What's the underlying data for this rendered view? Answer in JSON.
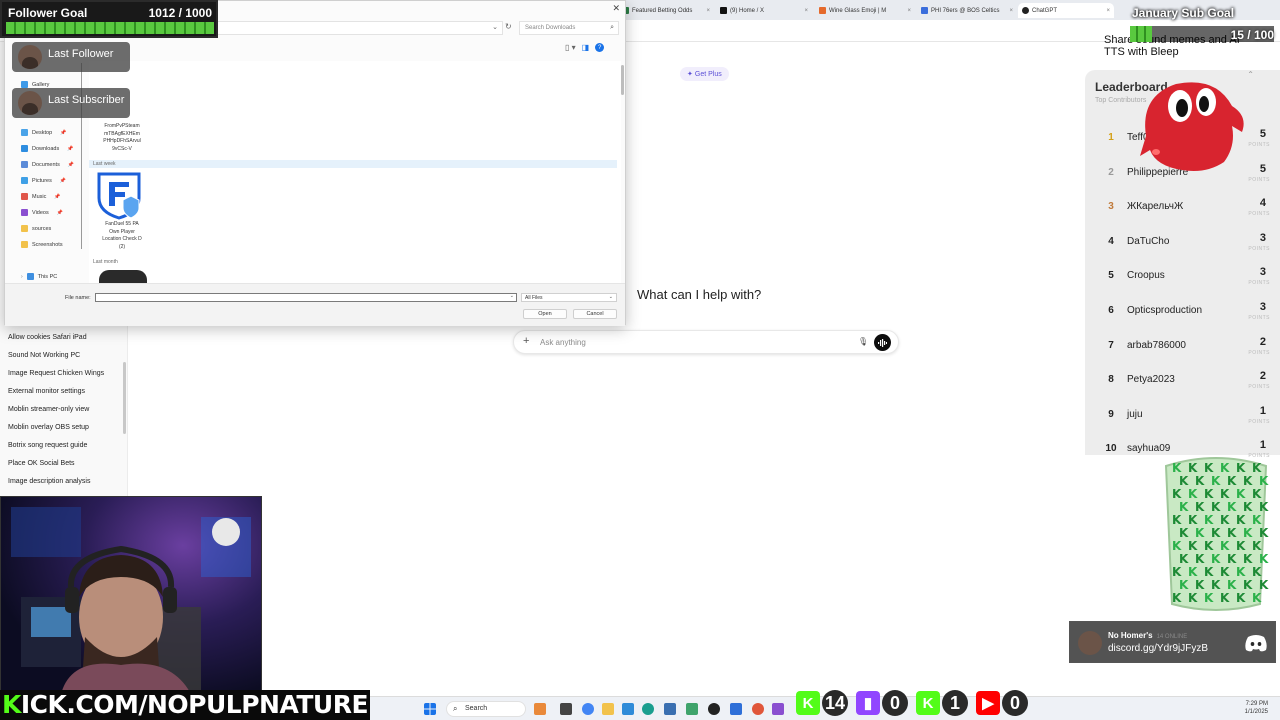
{
  "browser": {
    "tabs": [
      {
        "label": "Featured Betting Odds",
        "color": "#2d7d46"
      },
      {
        "label": "(9) Home / X",
        "color": "#111111"
      },
      {
        "label": "Wine Glass Emoji | M",
        "color": "#e56a2c"
      },
      {
        "label": "PHI 76ers @ BOS Celtics",
        "color": "#3b6edc"
      },
      {
        "label": "ChatGPT",
        "color": "#222222"
      }
    ]
  },
  "file_dialog": {
    "search_placeholder": "Search Downloads",
    "nav_items": [
      {
        "label": "Gallery",
        "color": "#3e9ae8"
      },
      {
        "label": "Desktop",
        "color": "#4aa3e8"
      },
      {
        "label": "Downloads",
        "color": "#2e8de0"
      },
      {
        "label": "Documents",
        "color": "#5b8bd8"
      },
      {
        "label": "Pictures",
        "color": "#3fa0e6"
      },
      {
        "label": "Music",
        "color": "#e0564a"
      },
      {
        "label": "Videos",
        "color": "#8a4fd0"
      },
      {
        "label": "sources",
        "color": "#f2c24b"
      },
      {
        "label": "Screenshots",
        "color": "#f2c24b"
      },
      {
        "label": "This PC",
        "color": "#3f8fe0"
      }
    ],
    "file_name_partial": "FromPvPSteam\nmTBAgfEXHEm\nPHHpDFhSArvul\n9vCSc-V",
    "group_last_week": "Last week",
    "file_fanduel": "FanDuel 55 PA\nOwn Player\nLocation Check D\n(2)",
    "group_last_month": "Last month",
    "file_name_label": "File name:",
    "file_type": "All Files",
    "open_label": "Open",
    "cancel_label": "Cancel"
  },
  "sidebar": {
    "chats": [
      "Allow cookies Safari iPad",
      "Sound Not Working PC",
      "Image Request Chicken Wings",
      "External monitor settings",
      "Moblin streamer-only view",
      "Moblin overlay OBS setup",
      "Botrix song request guide",
      "Place OK Social Bets",
      "Image description analysis"
    ]
  },
  "chatgpt": {
    "get_plus": "Get Plus",
    "prompt": "What can I help with?",
    "input_placeholder": "Ask anything"
  },
  "overlays": {
    "follower_goal": {
      "label": "Follower Goal",
      "count": "1012 / 1000",
      "progress": 1.0
    },
    "last_follower": "Last Follower",
    "last_subscriber": "Last Subscriber",
    "sub_goal": {
      "label": "January Sub Goal",
      "count": "15 / 100",
      "progress": 0.15
    },
    "share_text": "Share sound memes and AI TTS with Bleep",
    "leaderboard": {
      "title": "Leaderboard",
      "subtitle": "Top Contributors",
      "points_label": "POINTS",
      "rows": [
        {
          "rank": "1",
          "name": "Teff007",
          "points": "5",
          "rank_color": "#d4a017"
        },
        {
          "rank": "2",
          "name": "Philippepierre",
          "points": "5",
          "rank_color": "#9a9a9a"
        },
        {
          "rank": "3",
          "name": "ЖКарельчЖ",
          "points": "4",
          "rank_color": "#c07a3a"
        },
        {
          "rank": "4",
          "name": "DaTuCho",
          "points": "3",
          "rank_color": "#222222"
        },
        {
          "rank": "5",
          "name": "Croopus",
          "points": "3",
          "rank_color": "#222222"
        },
        {
          "rank": "6",
          "name": "Opticsproduction",
          "points": "3",
          "rank_color": "#222222"
        },
        {
          "rank": "7",
          "name": "arbab786000",
          "points": "2",
          "rank_color": "#222222"
        },
        {
          "rank": "8",
          "name": "Petya2023",
          "points": "2",
          "rank_color": "#222222"
        },
        {
          "rank": "9",
          "name": "juju",
          "points": "1",
          "rank_color": "#222222"
        },
        {
          "rank": "10",
          "name": "sayhua09",
          "points": "1",
          "rank_color": "#222222"
        }
      ]
    },
    "discord": {
      "name": "No Homer's",
      "online": "14 ONLINE",
      "link": "discord.gg/Ydr9jJFyzB"
    },
    "kick_prefix": "K",
    "kick_handle": "ICK.COM/NOPULPNATURE",
    "counters": [
      {
        "icon": "kick-icon",
        "value": "14",
        "color": "#53fc18"
      },
      {
        "icon": "twitch-icon",
        "value": "0",
        "color": "#9146ff"
      },
      {
        "icon": "kick-icon",
        "value": "1",
        "color": "#53fc18"
      },
      {
        "icon": "youtube-icon",
        "value": "0",
        "color": "#ff0000"
      }
    ]
  },
  "taskbar": {
    "search_placeholder": "Search",
    "time": "7:29 PM",
    "date": "1/1/2025"
  }
}
